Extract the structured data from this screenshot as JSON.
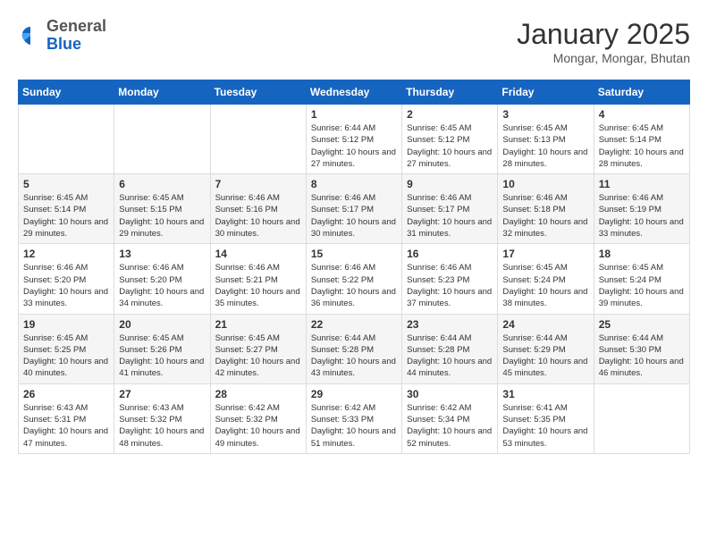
{
  "logo": {
    "general": "General",
    "blue": "Blue"
  },
  "header": {
    "month": "January 2025",
    "location": "Mongar, Mongar, Bhutan"
  },
  "days_of_week": [
    "Sunday",
    "Monday",
    "Tuesday",
    "Wednesday",
    "Thursday",
    "Friday",
    "Saturday"
  ],
  "weeks": [
    [
      {
        "day": "",
        "info": ""
      },
      {
        "day": "",
        "info": ""
      },
      {
        "day": "",
        "info": ""
      },
      {
        "day": "1",
        "info": "Sunrise: 6:44 AM\nSunset: 5:12 PM\nDaylight: 10 hours\nand 27 minutes."
      },
      {
        "day": "2",
        "info": "Sunrise: 6:45 AM\nSunset: 5:12 PM\nDaylight: 10 hours\nand 27 minutes."
      },
      {
        "day": "3",
        "info": "Sunrise: 6:45 AM\nSunset: 5:13 PM\nDaylight: 10 hours\nand 28 minutes."
      },
      {
        "day": "4",
        "info": "Sunrise: 6:45 AM\nSunset: 5:14 PM\nDaylight: 10 hours\nand 28 minutes."
      }
    ],
    [
      {
        "day": "5",
        "info": "Sunrise: 6:45 AM\nSunset: 5:14 PM\nDaylight: 10 hours\nand 29 minutes."
      },
      {
        "day": "6",
        "info": "Sunrise: 6:45 AM\nSunset: 5:15 PM\nDaylight: 10 hours\nand 29 minutes."
      },
      {
        "day": "7",
        "info": "Sunrise: 6:46 AM\nSunset: 5:16 PM\nDaylight: 10 hours\nand 30 minutes."
      },
      {
        "day": "8",
        "info": "Sunrise: 6:46 AM\nSunset: 5:17 PM\nDaylight: 10 hours\nand 30 minutes."
      },
      {
        "day": "9",
        "info": "Sunrise: 6:46 AM\nSunset: 5:17 PM\nDaylight: 10 hours\nand 31 minutes."
      },
      {
        "day": "10",
        "info": "Sunrise: 6:46 AM\nSunset: 5:18 PM\nDaylight: 10 hours\nand 32 minutes."
      },
      {
        "day": "11",
        "info": "Sunrise: 6:46 AM\nSunset: 5:19 PM\nDaylight: 10 hours\nand 33 minutes."
      }
    ],
    [
      {
        "day": "12",
        "info": "Sunrise: 6:46 AM\nSunset: 5:20 PM\nDaylight: 10 hours\nand 33 minutes."
      },
      {
        "day": "13",
        "info": "Sunrise: 6:46 AM\nSunset: 5:20 PM\nDaylight: 10 hours\nand 34 minutes."
      },
      {
        "day": "14",
        "info": "Sunrise: 6:46 AM\nSunset: 5:21 PM\nDaylight: 10 hours\nand 35 minutes."
      },
      {
        "day": "15",
        "info": "Sunrise: 6:46 AM\nSunset: 5:22 PM\nDaylight: 10 hours\nand 36 minutes."
      },
      {
        "day": "16",
        "info": "Sunrise: 6:46 AM\nSunset: 5:23 PM\nDaylight: 10 hours\nand 37 minutes."
      },
      {
        "day": "17",
        "info": "Sunrise: 6:45 AM\nSunset: 5:24 PM\nDaylight: 10 hours\nand 38 minutes."
      },
      {
        "day": "18",
        "info": "Sunrise: 6:45 AM\nSunset: 5:24 PM\nDaylight: 10 hours\nand 39 minutes."
      }
    ],
    [
      {
        "day": "19",
        "info": "Sunrise: 6:45 AM\nSunset: 5:25 PM\nDaylight: 10 hours\nand 40 minutes."
      },
      {
        "day": "20",
        "info": "Sunrise: 6:45 AM\nSunset: 5:26 PM\nDaylight: 10 hours\nand 41 minutes."
      },
      {
        "day": "21",
        "info": "Sunrise: 6:45 AM\nSunset: 5:27 PM\nDaylight: 10 hours\nand 42 minutes."
      },
      {
        "day": "22",
        "info": "Sunrise: 6:44 AM\nSunset: 5:28 PM\nDaylight: 10 hours\nand 43 minutes."
      },
      {
        "day": "23",
        "info": "Sunrise: 6:44 AM\nSunset: 5:28 PM\nDaylight: 10 hours\nand 44 minutes."
      },
      {
        "day": "24",
        "info": "Sunrise: 6:44 AM\nSunset: 5:29 PM\nDaylight: 10 hours\nand 45 minutes."
      },
      {
        "day": "25",
        "info": "Sunrise: 6:44 AM\nSunset: 5:30 PM\nDaylight: 10 hours\nand 46 minutes."
      }
    ],
    [
      {
        "day": "26",
        "info": "Sunrise: 6:43 AM\nSunset: 5:31 PM\nDaylight: 10 hours\nand 47 minutes."
      },
      {
        "day": "27",
        "info": "Sunrise: 6:43 AM\nSunset: 5:32 PM\nDaylight: 10 hours\nand 48 minutes."
      },
      {
        "day": "28",
        "info": "Sunrise: 6:42 AM\nSunset: 5:32 PM\nDaylight: 10 hours\nand 49 minutes."
      },
      {
        "day": "29",
        "info": "Sunrise: 6:42 AM\nSunset: 5:33 PM\nDaylight: 10 hours\nand 51 minutes."
      },
      {
        "day": "30",
        "info": "Sunrise: 6:42 AM\nSunset: 5:34 PM\nDaylight: 10 hours\nand 52 minutes."
      },
      {
        "day": "31",
        "info": "Sunrise: 6:41 AM\nSunset: 5:35 PM\nDaylight: 10 hours\nand 53 minutes."
      },
      {
        "day": "",
        "info": ""
      }
    ]
  ]
}
